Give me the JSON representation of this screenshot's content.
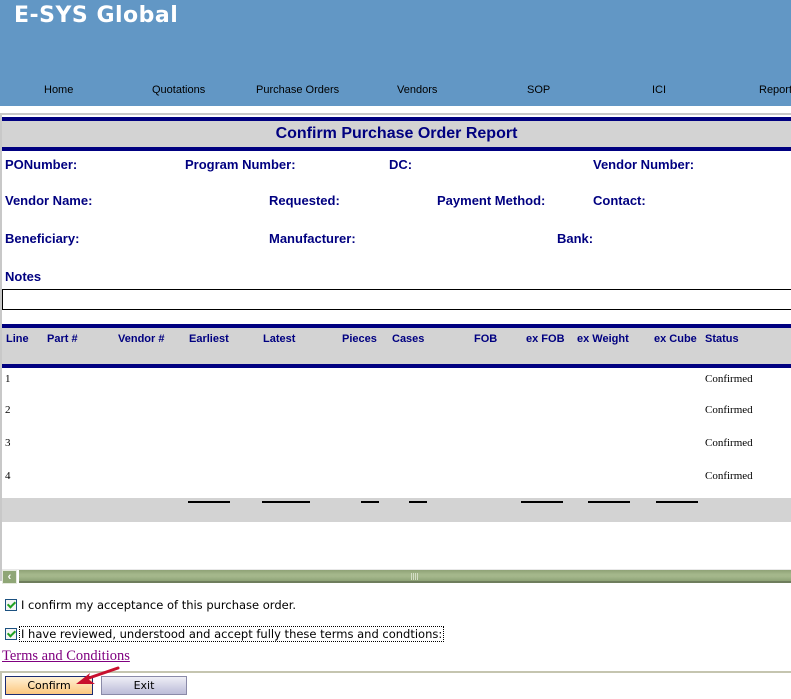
{
  "app": {
    "title": "E-SYS Global"
  },
  "nav": {
    "items": [
      {
        "label": "Home"
      },
      {
        "label": "Quotations"
      },
      {
        "label": "Purchase Orders"
      },
      {
        "label": "Vendors"
      },
      {
        "label": "SOP"
      },
      {
        "label": "ICI"
      },
      {
        "label": "Report"
      }
    ]
  },
  "report": {
    "title": "Confirm Purchase Order Report",
    "fields": {
      "po_number": "PONumber:",
      "program_number": "Program Number:",
      "dc": "DC:",
      "vendor_number": "Vendor Number:",
      "vendor_name": "Vendor Name:",
      "requested": "Requested:",
      "payment_method": "Payment Method:",
      "contact": "Contact:",
      "beneficiary": "Beneficiary:",
      "manufacturer": "Manufacturer:",
      "bank": "Bank:",
      "notes": "Notes"
    },
    "notes_value": ""
  },
  "grid": {
    "columns": [
      "Line",
      "Part #",
      "Vendor #",
      "Earliest",
      "Latest",
      "Pieces",
      "Cases",
      "FOB",
      "ex FOB",
      "ex Weight",
      "ex Cube",
      "Status"
    ],
    "rows": [
      {
        "line": "1",
        "status": "Confirmed"
      },
      {
        "line": "2",
        "status": "Confirmed"
      },
      {
        "line": "3",
        "status": "Confirmed"
      },
      {
        "line": "4",
        "status": "Confirmed"
      }
    ]
  },
  "acceptance": {
    "confirm_checkbox": {
      "label": "I confirm my acceptance of this purchase order.",
      "checked": true
    },
    "terms_checkbox": {
      "label": "I have reviewed, understood and accept fully these terms and condtions:",
      "checked": true
    },
    "terms_link": "Terms and Conditions"
  },
  "buttons": {
    "confirm": "Confirm",
    "exit": "Exit"
  },
  "colors": {
    "header_bg": "#6297c5",
    "accent_navy": "#000080",
    "grid_bg": "#d3d3d3",
    "link_visited": "#800080",
    "scrollbar": "#a4b78b"
  }
}
